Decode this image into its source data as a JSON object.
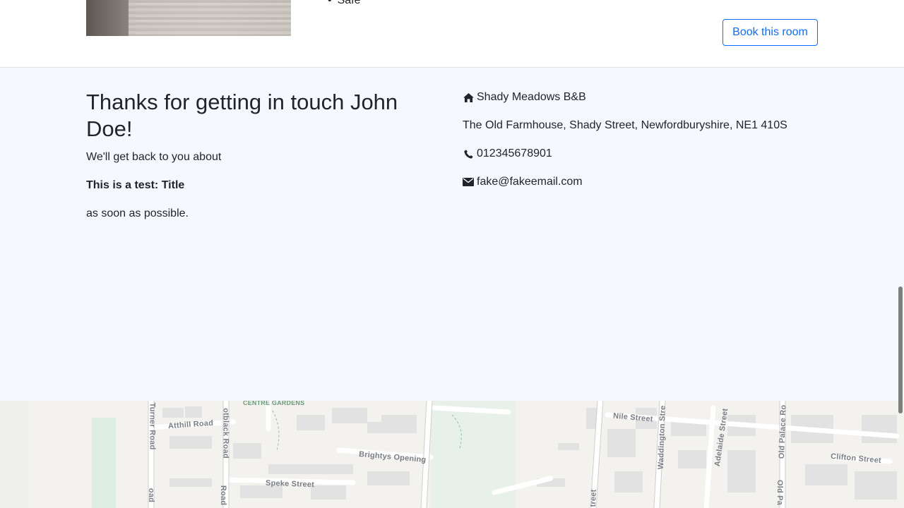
{
  "room": {
    "amenity": "Safe",
    "book_button": "Book this room"
  },
  "contact": {
    "title": "Thanks for getting in touch John Doe!",
    "line1": "We'll get back to you about",
    "subject": "This is a test: Title",
    "line3": "as soon as possible."
  },
  "business": {
    "name": "Shady Meadows B&B",
    "address": "The Old Farmhouse, Shady Street, Newfordburyshire, NE1 410S",
    "phone": "012345678901",
    "email": "fake@fakeemail.com",
    "icons": [
      "home-icon",
      "phone-icon",
      "envelope-icon"
    ]
  },
  "map": {
    "labels": {
      "centre_gardens": "CENTRE GARDENS",
      "atthill": "Atthill Road",
      "turner": "Turner Road",
      "blackroad": "otblack Road",
      "brightys": "Brightys Opening",
      "speke": "Speke Street",
      "nile": "Nile Street",
      "waddington": "Waddington Stre",
      "adelaide": "Adelaide Street",
      "oldpalace": "Old Palace Ro",
      "clifton": "Clifton Street",
      "oldpa2": "Old Pa",
      "street_frag": "treet",
      "road_frag1": "oad",
      "road_frag2": "Road"
    }
  }
}
